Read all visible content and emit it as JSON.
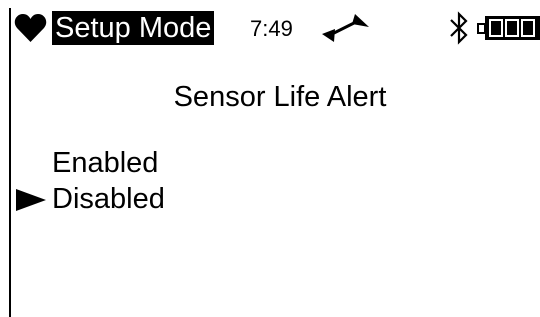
{
  "status_bar": {
    "mode": "Setup Mode",
    "time": "7:49",
    "heart_icon": "heart-icon",
    "signal_icon": "signal-icon",
    "bluetooth_icon": "bluetooth-icon",
    "battery_icon": "battery-icon",
    "battery_level": 1.0
  },
  "screen": {
    "title": "Sensor Life Alert",
    "options": [
      {
        "label": "Enabled",
        "selected": false
      },
      {
        "label": "Disabled",
        "selected": true
      }
    ],
    "selection_icon": "triangle-right-icon"
  }
}
